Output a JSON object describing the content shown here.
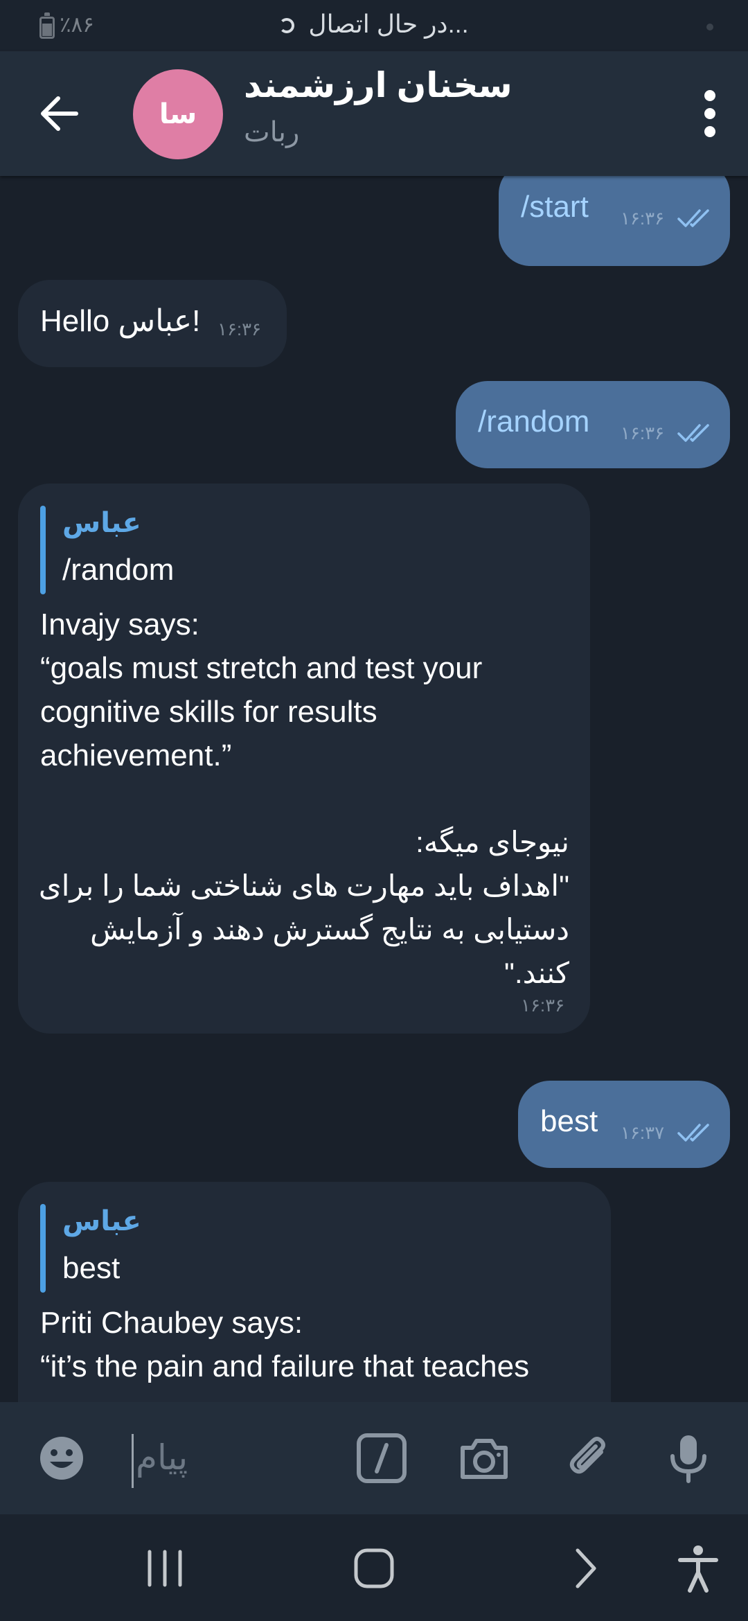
{
  "status_bar": {
    "battery": "٪۸۶",
    "connection": "در حال اتصال..."
  },
  "header": {
    "avatar_initials": "سا",
    "title": "سخنان ارزشمند",
    "subtitle": "ربات"
  },
  "messages": [
    {
      "dir": "out",
      "text": "/start",
      "time": "۱۶:۳۶"
    },
    {
      "dir": "in",
      "text": "Hello عباس!",
      "time": "۱۶:۳۶"
    },
    {
      "dir": "out",
      "text": "/random",
      "time": "۱۶:۳۶"
    },
    {
      "dir": "in",
      "reply_name": "عباس",
      "reply_text": "/random",
      "text": "Invajy says:\n“goals must stretch and test your\ncognitive skills for results\nachievement.”",
      "text_fa": "نیوجای میگه:\n\"اهداف باید مهارت های شناختی شما را برای\nدستیابی به نتایج گسترش دهند و آزمایش\nکنند.\"",
      "time": "۱۶:۳۶"
    },
    {
      "dir": "out",
      "text": "best",
      "time": "۱۶:۳۷"
    },
    {
      "dir": "in",
      "reply_name": "عباس",
      "reply_text": "best",
      "text": "Priti Chaubey says:\n“it’s the pain and failure that teaches"
    }
  ],
  "input": {
    "placeholder": "پیام"
  },
  "colors": {
    "background": "#19202a",
    "header": "#232e3b",
    "outgoing": "#4b6f9a",
    "incoming": "#212a37",
    "accent": "#5ea8e6",
    "avatar": "#df7ea5"
  }
}
